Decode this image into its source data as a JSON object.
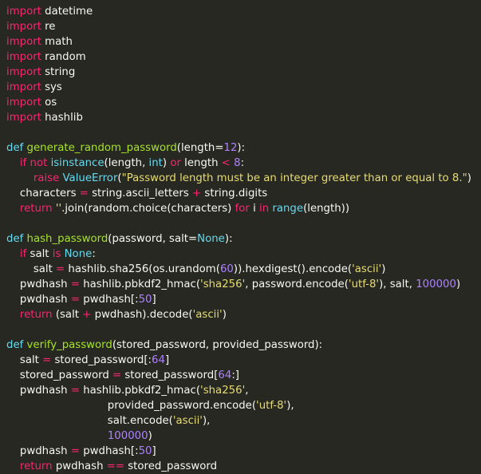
{
  "theme": {
    "background": "#272822",
    "text": "#f8f8f2",
    "keyword": "#f92672",
    "function": "#a6e22e",
    "builtin": "#66d9ef",
    "string": "#e6db74",
    "number": "#ae81ff"
  },
  "lines": [
    [
      [
        "kw",
        "import"
      ],
      [
        "txt",
        " datetime"
      ]
    ],
    [
      [
        "kw",
        "import"
      ],
      [
        "txt",
        " re"
      ]
    ],
    [
      [
        "kw",
        "import"
      ],
      [
        "txt",
        " math"
      ]
    ],
    [
      [
        "kw",
        "import"
      ],
      [
        "txt",
        " random"
      ]
    ],
    [
      [
        "kw",
        "import"
      ],
      [
        "txt",
        " string"
      ]
    ],
    [
      [
        "kw",
        "import"
      ],
      [
        "txt",
        " sys"
      ]
    ],
    [
      [
        "kw",
        "import"
      ],
      [
        "txt",
        " os"
      ]
    ],
    [
      [
        "kw",
        "import"
      ],
      [
        "txt",
        " hashlib"
      ]
    ],
    [],
    [
      [
        "bi",
        "def"
      ],
      [
        "txt",
        " "
      ],
      [
        "fn",
        "generate_random_password"
      ],
      [
        "txt",
        "(length="
      ],
      [
        "num",
        "12"
      ],
      [
        "txt",
        "):"
      ]
    ],
    [
      [
        "txt",
        "    "
      ],
      [
        "kw",
        "if"
      ],
      [
        "txt",
        " "
      ],
      [
        "kw",
        "not"
      ],
      [
        "txt",
        " "
      ],
      [
        "bi",
        "isinstance"
      ],
      [
        "txt",
        "(length, "
      ],
      [
        "bi",
        "int"
      ],
      [
        "txt",
        ") "
      ],
      [
        "kw",
        "or"
      ],
      [
        "txt",
        " length "
      ],
      [
        "op",
        "<"
      ],
      [
        "txt",
        " "
      ],
      [
        "num",
        "8"
      ],
      [
        "txt",
        ":"
      ]
    ],
    [
      [
        "txt",
        "        "
      ],
      [
        "kw",
        "raise"
      ],
      [
        "txt",
        " "
      ],
      [
        "bi",
        "ValueError"
      ],
      [
        "txt",
        "("
      ],
      [
        "str",
        "\"Password length must be an integer greater than or equal to 8.\""
      ],
      [
        "txt",
        ")"
      ]
    ],
    [
      [
        "txt",
        "    characters "
      ],
      [
        "op",
        "="
      ],
      [
        "txt",
        " string.ascii_letters "
      ],
      [
        "op",
        "+"
      ],
      [
        "txt",
        " string.digits"
      ]
    ],
    [
      [
        "txt",
        "    "
      ],
      [
        "kw",
        "return"
      ],
      [
        "txt",
        " "
      ],
      [
        "str",
        "''"
      ],
      [
        "txt",
        ".join(random.choice(characters) "
      ],
      [
        "kw",
        "for"
      ],
      [
        "txt",
        " i "
      ],
      [
        "kw",
        "in"
      ],
      [
        "txt",
        " "
      ],
      [
        "bi",
        "range"
      ],
      [
        "txt",
        "(length))"
      ]
    ],
    [],
    [
      [
        "bi",
        "def"
      ],
      [
        "txt",
        " "
      ],
      [
        "fn",
        "hash_password"
      ],
      [
        "txt",
        "(password, salt="
      ],
      [
        "bi",
        "None"
      ],
      [
        "txt",
        "):"
      ]
    ],
    [
      [
        "txt",
        "    "
      ],
      [
        "kw",
        "if"
      ],
      [
        "txt",
        " salt "
      ],
      [
        "kw",
        "is"
      ],
      [
        "txt",
        " "
      ],
      [
        "bi",
        "None"
      ],
      [
        "txt",
        ":"
      ]
    ],
    [
      [
        "txt",
        "        salt "
      ],
      [
        "op",
        "="
      ],
      [
        "txt",
        " hashlib.sha256(os.urandom("
      ],
      [
        "num",
        "60"
      ],
      [
        "txt",
        ")).hexdigest().encode("
      ],
      [
        "str",
        "'ascii'"
      ],
      [
        "txt",
        ")"
      ]
    ],
    [
      [
        "txt",
        "    pwdhash "
      ],
      [
        "op",
        "="
      ],
      [
        "txt",
        " hashlib.pbkdf2_hmac("
      ],
      [
        "str",
        "'sha256'"
      ],
      [
        "txt",
        ", password.encode("
      ],
      [
        "str",
        "'utf-8'"
      ],
      [
        "txt",
        "), salt, "
      ],
      [
        "num",
        "100000"
      ],
      [
        "txt",
        ")"
      ]
    ],
    [
      [
        "txt",
        "    pwdhash "
      ],
      [
        "op",
        "="
      ],
      [
        "txt",
        " pwdhash[:"
      ],
      [
        "num",
        "50"
      ],
      [
        "txt",
        "]"
      ]
    ],
    [
      [
        "txt",
        "    "
      ],
      [
        "kw",
        "return"
      ],
      [
        "txt",
        " (salt "
      ],
      [
        "op",
        "+"
      ],
      [
        "txt",
        " pwdhash).decode("
      ],
      [
        "str",
        "'ascii'"
      ],
      [
        "txt",
        ")"
      ]
    ],
    [],
    [
      [
        "bi",
        "def"
      ],
      [
        "txt",
        " "
      ],
      [
        "fn",
        "verify_password"
      ],
      [
        "txt",
        "(stored_password, provided_password):"
      ]
    ],
    [
      [
        "txt",
        "    salt "
      ],
      [
        "op",
        "="
      ],
      [
        "txt",
        " stored_password[:"
      ],
      [
        "num",
        "64"
      ],
      [
        "txt",
        "]"
      ]
    ],
    [
      [
        "txt",
        "    stored_password "
      ],
      [
        "op",
        "="
      ],
      [
        "txt",
        " stored_password["
      ],
      [
        "num",
        "64"
      ],
      [
        "txt",
        ":]"
      ]
    ],
    [
      [
        "txt",
        "    pwdhash "
      ],
      [
        "op",
        "="
      ],
      [
        "txt",
        " hashlib.pbkdf2_hmac("
      ],
      [
        "str",
        "'sha256'"
      ],
      [
        "txt",
        ","
      ]
    ],
    [
      [
        "txt",
        "                              provided_password.encode("
      ],
      [
        "str",
        "'utf-8'"
      ],
      [
        "txt",
        "),"
      ]
    ],
    [
      [
        "txt",
        "                              salt.encode("
      ],
      [
        "str",
        "'ascii'"
      ],
      [
        "txt",
        "),"
      ]
    ],
    [
      [
        "txt",
        "                              "
      ],
      [
        "num",
        "100000"
      ],
      [
        "txt",
        ")"
      ]
    ],
    [
      [
        "txt",
        "    pwdhash "
      ],
      [
        "op",
        "="
      ],
      [
        "txt",
        " pwdhash[:"
      ],
      [
        "num",
        "50"
      ],
      [
        "txt",
        "]"
      ]
    ],
    [
      [
        "txt",
        "    "
      ],
      [
        "kw",
        "return"
      ],
      [
        "txt",
        " pwdhash "
      ],
      [
        "op",
        "=="
      ],
      [
        "txt",
        " stored_password"
      ]
    ]
  ]
}
